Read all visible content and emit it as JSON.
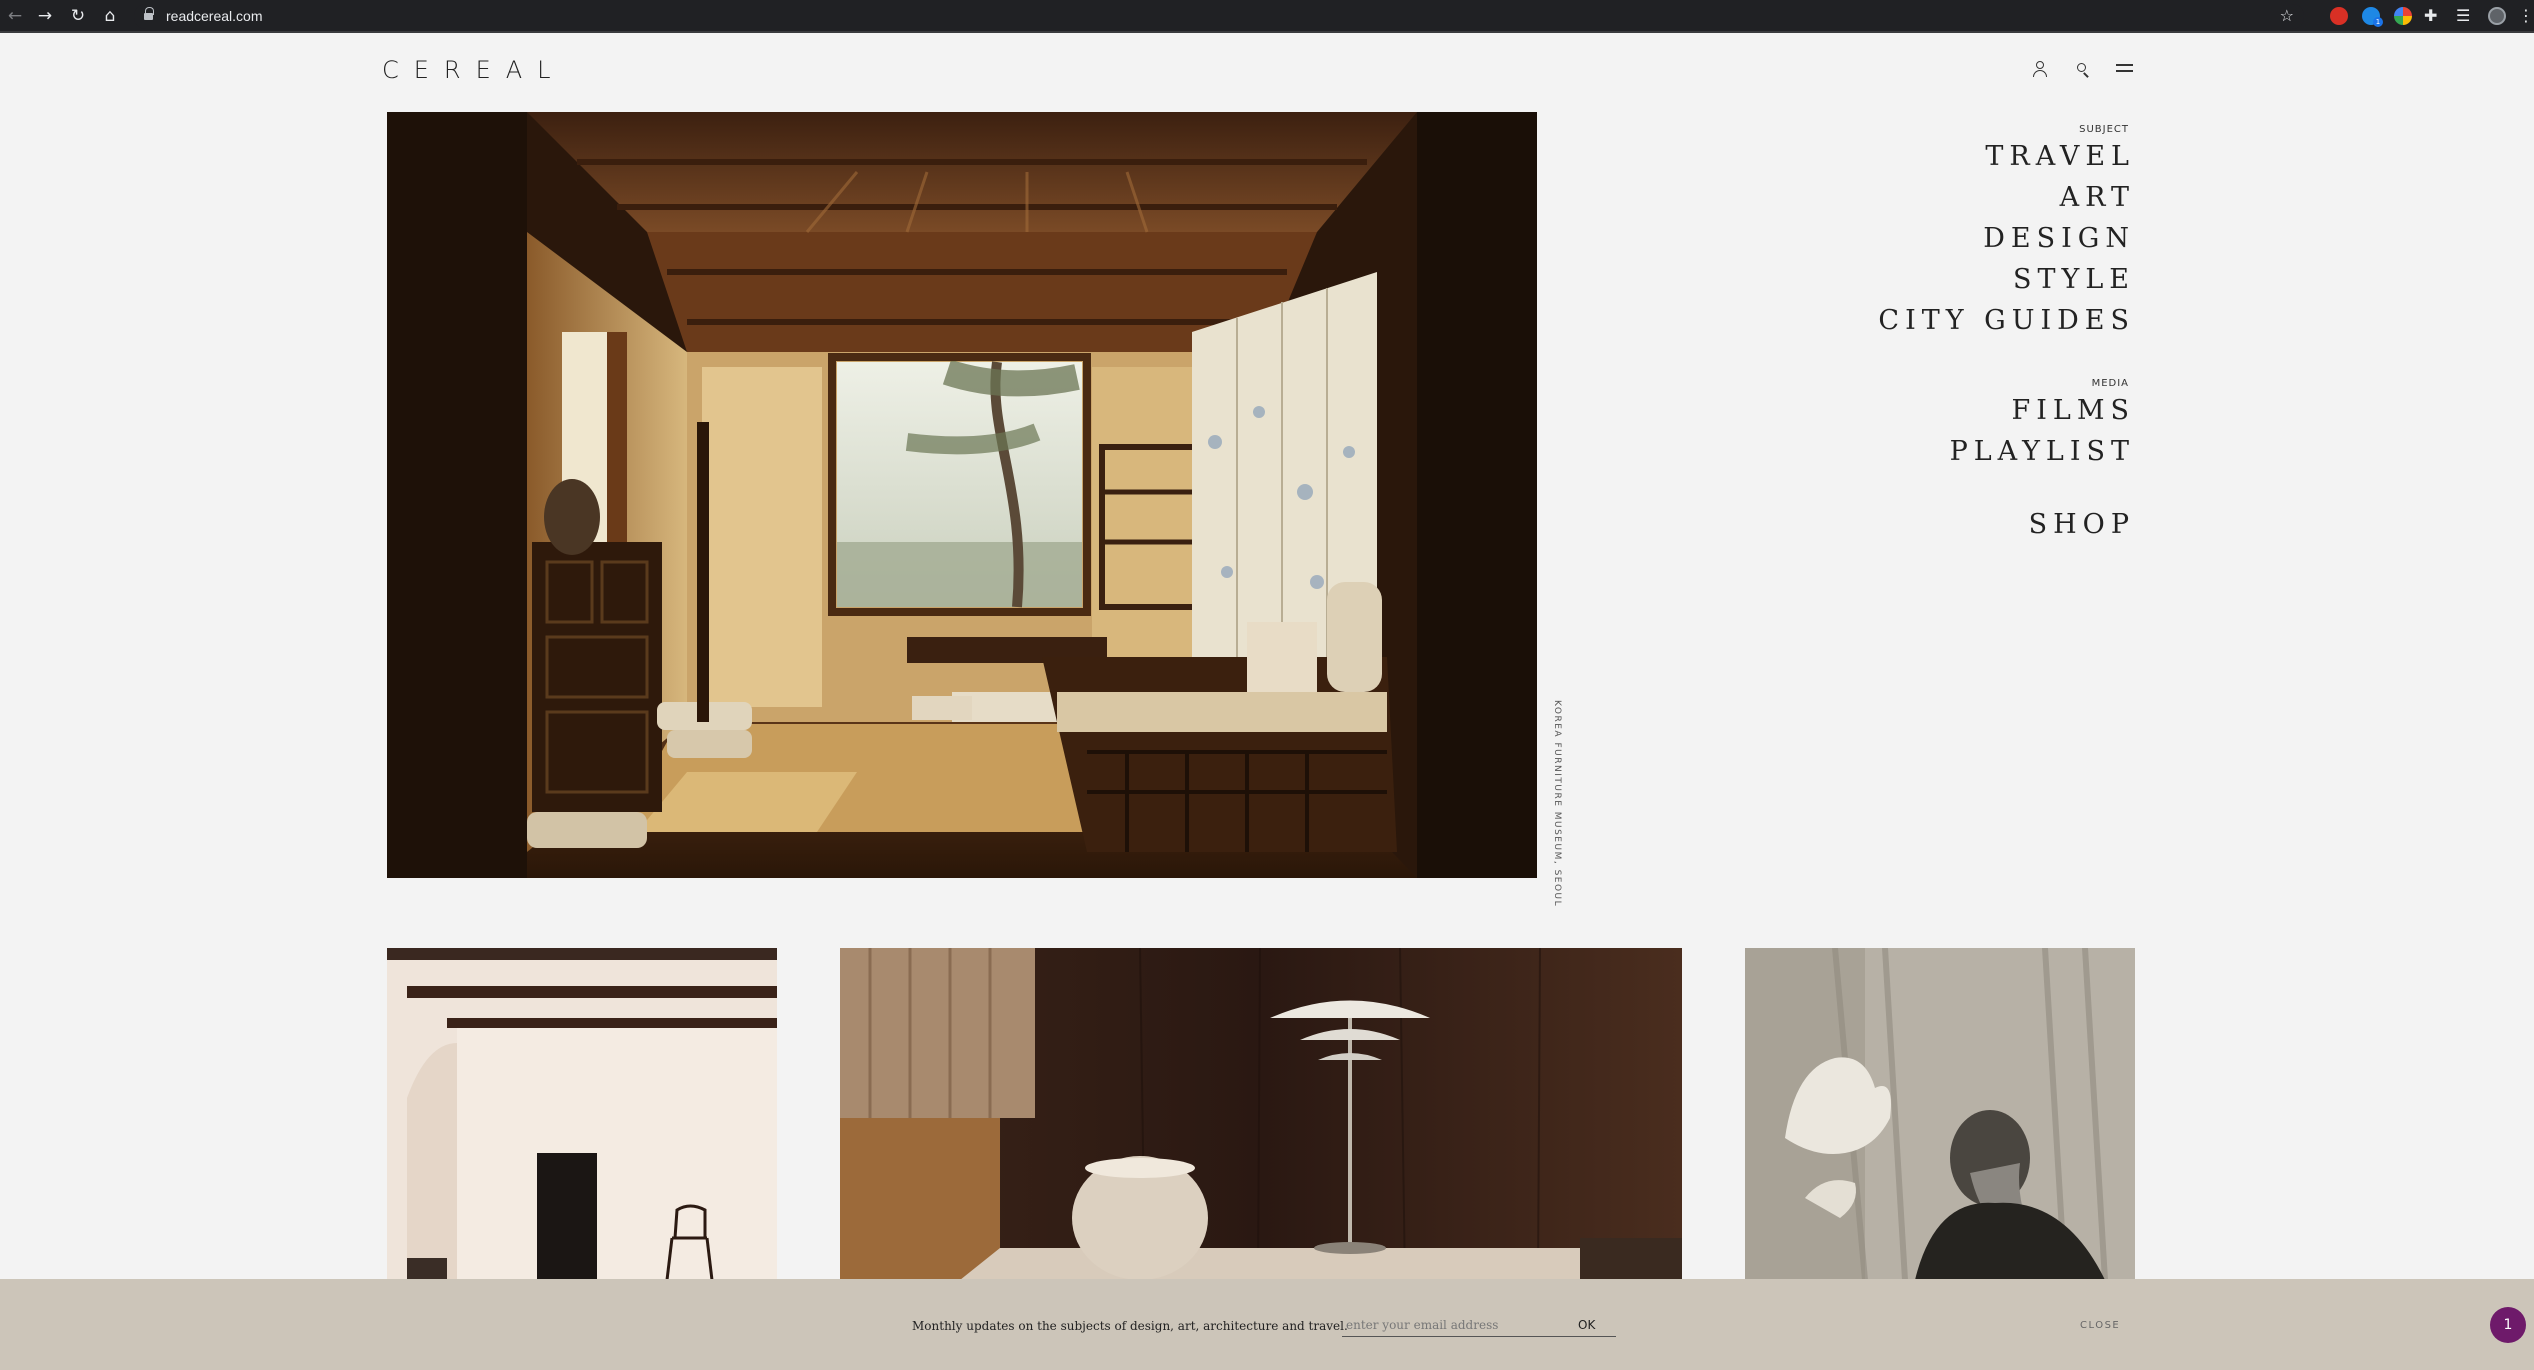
{
  "browser": {
    "url": "readcereal.com",
    "extension_badge": "1"
  },
  "site": {
    "logo": "CEREAL"
  },
  "hero": {
    "caption": "KOREA FURNITURE MUSEUM, SEOUL"
  },
  "menu": {
    "subject_label": "SUBJECT",
    "subject_items": [
      "TRAVEL",
      "ART",
      "DESIGN",
      "STYLE",
      "CITY GUIDES"
    ],
    "media_label": "MEDIA",
    "media_items": [
      "FILMS",
      "PLAYLIST"
    ],
    "shop": "SHOP"
  },
  "newsletter": {
    "message": "Monthly updates on the subjects of design, art, architecture and travel.",
    "placeholder": "enter your email address",
    "ok_label": "OK",
    "close_label": "CLOSE"
  },
  "notification": {
    "count": "1",
    "color": "#6e1a6a"
  },
  "colors": {
    "page_background": "#f3f3f3",
    "newsletter_background": "#ccc5b9",
    "browser_chrome": "#202124"
  }
}
